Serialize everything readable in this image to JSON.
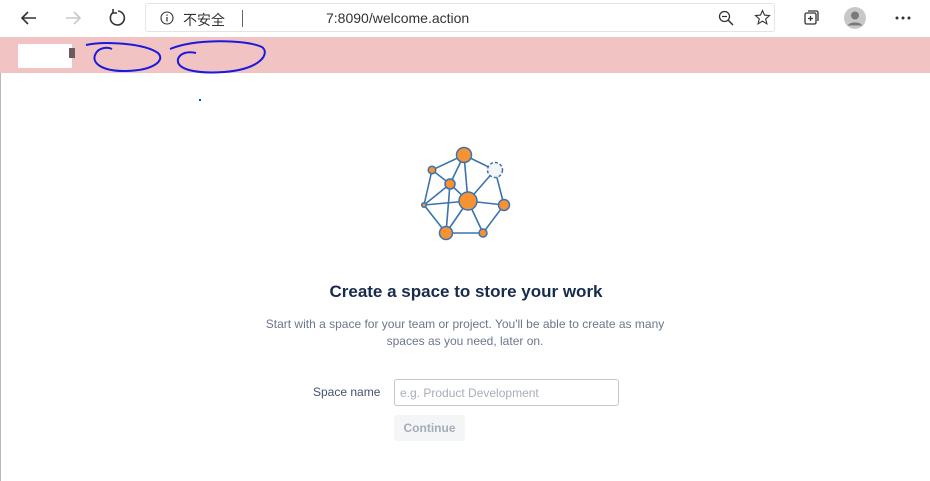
{
  "browser": {
    "security_label": "不安全",
    "url": "7:8090/welcome.action"
  },
  "main": {
    "title": "Create a space to store your work",
    "description": "Start with a space for your team or project. You'll be able to create as many spaces as you need, later on.",
    "field_label": "Space name",
    "field_placeholder": "e.g. Product Development",
    "field_value": "",
    "button_label": "Continue"
  },
  "colors": {
    "header_bg": "#f2c3c3",
    "node_fill": "#f79232",
    "node_stroke": "#3b73af",
    "title_text": "#172b4d"
  }
}
